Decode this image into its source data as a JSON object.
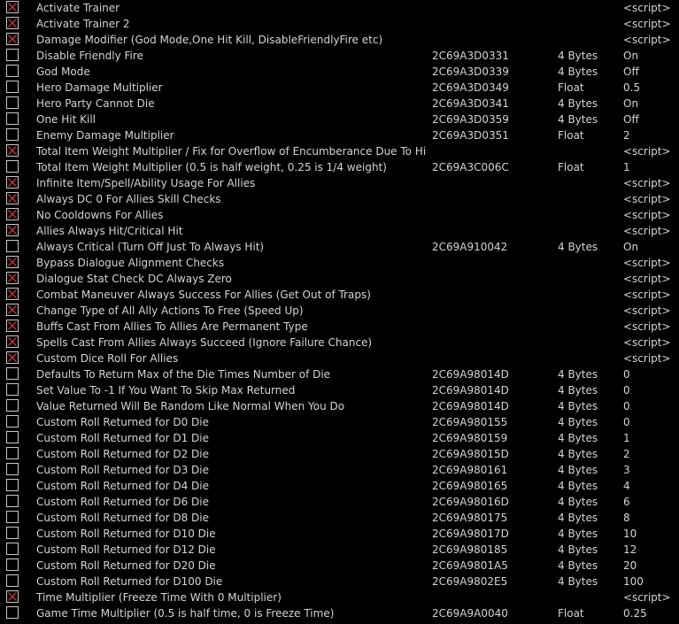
{
  "theme": {
    "background": "#000000",
    "text": "#d4d4d4",
    "check_mark": "#c0392b",
    "checkbox_border": "#c8c8c8"
  },
  "rows": [
    {
      "checked": true,
      "description": "Activate Trainer",
      "address": "",
      "type": "",
      "value": "<script>"
    },
    {
      "checked": true,
      "description": "Activate Trainer 2",
      "address": "",
      "type": "",
      "value": "<script>"
    },
    {
      "checked": true,
      "description": "Damage Modifier (God Mode,One Hit Kill, DisableFriendlyFire etc)",
      "address": "",
      "type": "",
      "value": "<script>"
    },
    {
      "checked": false,
      "description": "Disable Friendly Fire",
      "address": "2C69A3D0331",
      "type": "4 Bytes",
      "value": "On"
    },
    {
      "checked": false,
      "description": "God Mode",
      "address": "2C69A3D0339",
      "type": "4 Bytes",
      "value": "Off"
    },
    {
      "checked": false,
      "description": "Hero Damage Multiplier",
      "address": "2C69A3D0349",
      "type": "Float",
      "value": "0.5"
    },
    {
      "checked": false,
      "description": "Hero Party Cannot Die",
      "address": "2C69A3D0341",
      "type": "4 Bytes",
      "value": "On"
    },
    {
      "checked": false,
      "description": "One Hit Kill",
      "address": "2C69A3D0359",
      "type": "4 Bytes",
      "value": "Off"
    },
    {
      "checked": false,
      "description": "Enemy Damage Multiplier",
      "address": "2C69A3D0351",
      "type": "Float",
      "value": "2"
    },
    {
      "checked": true,
      "description": "Total Item Weight Multiplier / Fix for Overflow of Encumberance Due To High STR (Default Normal Weight)",
      "address": "",
      "type": "",
      "value": "<script>"
    },
    {
      "checked": false,
      "description": "Total Item Weight Multiplier (0.5 is half weight, 0.25 is 1/4 weight)",
      "address": "2C69A3C006C",
      "type": "Float",
      "value": "1"
    },
    {
      "checked": true,
      "description": "Infinite Item/Spell/Ability Usage For Allies",
      "address": "",
      "type": "",
      "value": "<script>"
    },
    {
      "checked": true,
      "description": "Always DC 0 For Allies Skill Checks",
      "address": "",
      "type": "",
      "value": "<script>"
    },
    {
      "checked": true,
      "description": "No Cooldowns For Allies",
      "address": "",
      "type": "",
      "value": "<script>"
    },
    {
      "checked": true,
      "description": "Allies Always Hit/Critical Hit",
      "address": "",
      "type": "",
      "value": "<script>"
    },
    {
      "checked": false,
      "description": "Always Critical (Turn Off Just To Always Hit)",
      "address": "2C69A910042",
      "type": "4 Bytes",
      "value": "On"
    },
    {
      "checked": true,
      "description": "Bypass Dialogue Alignment Checks",
      "address": "",
      "type": "",
      "value": "<script>"
    },
    {
      "checked": true,
      "description": "Dialogue Stat Check DC Always Zero",
      "address": "",
      "type": "",
      "value": "<script>"
    },
    {
      "checked": true,
      "description": "Combat Maneuver Always Success For Allies (Get Out of Traps)",
      "address": "",
      "type": "",
      "value": "<script>"
    },
    {
      "checked": true,
      "description": "Change Type of All Ally Actions To Free (Speed Up)",
      "address": "",
      "type": "",
      "value": "<script>"
    },
    {
      "checked": true,
      "description": "Buffs Cast From Allies To Allies Are Permanent Type",
      "address": "",
      "type": "",
      "value": "<script>"
    },
    {
      "checked": true,
      "description": "Spells Cast From Allies Always Succeed (Ignore Failure Chance)",
      "address": "",
      "type": "",
      "value": "<script>"
    },
    {
      "checked": true,
      "description": "Custom Dice Roll For Allies",
      "address": "",
      "type": "",
      "value": "<script>"
    },
    {
      "checked": false,
      "description": "Defaults To Return Max of the Die Times Number of Die",
      "address": "2C69A98014D",
      "type": "4 Bytes",
      "value": "0"
    },
    {
      "checked": false,
      "description": "Set Value To -1 If You Want To Skip Max Returned",
      "address": "2C69A98014D",
      "type": "4 Bytes",
      "value": "0"
    },
    {
      "checked": false,
      "description": "Value Returned Will Be Random Like Normal When You Do",
      "address": "2C69A98014D",
      "type": "4 Bytes",
      "value": "0"
    },
    {
      "checked": false,
      "description": "Custom Roll Returned for D0 Die",
      "address": "2C69A980155",
      "type": "4 Bytes",
      "value": "0"
    },
    {
      "checked": false,
      "description": "Custom Roll Returned for D1 Die",
      "address": "2C69A980159",
      "type": "4 Bytes",
      "value": "1"
    },
    {
      "checked": false,
      "description": "Custom Roll Returned for D2 Die",
      "address": "2C69A98015D",
      "type": "4 Bytes",
      "value": "2"
    },
    {
      "checked": false,
      "description": "Custom Roll Returned for D3 Die",
      "address": "2C69A980161",
      "type": "4 Bytes",
      "value": "3"
    },
    {
      "checked": false,
      "description": "Custom Roll Returned for D4 Die",
      "address": "2C69A980165",
      "type": "4 Bytes",
      "value": "4"
    },
    {
      "checked": false,
      "description": "Custom Roll Returned for D6 Die",
      "address": "2C69A98016D",
      "type": "4 Bytes",
      "value": "6"
    },
    {
      "checked": false,
      "description": "Custom Roll Returned for D8 Die",
      "address": "2C69A980175",
      "type": "4 Bytes",
      "value": "8"
    },
    {
      "checked": false,
      "description": "Custom Roll Returned for D10 Die",
      "address": "2C69A98017D",
      "type": "4 Bytes",
      "value": "10"
    },
    {
      "checked": false,
      "description": "Custom Roll Returned for D12 Die",
      "address": "2C69A980185",
      "type": "4 Bytes",
      "value": "12"
    },
    {
      "checked": false,
      "description": "Custom Roll Returned for D20 Die",
      "address": "2C69A9801A5",
      "type": "4 Bytes",
      "value": "20"
    },
    {
      "checked": false,
      "description": "Custom Roll Returned for D100 Die",
      "address": "2C69A9802E5",
      "type": "4 Bytes",
      "value": "100"
    },
    {
      "checked": true,
      "description": "Time Multiplier (Freeze Time With 0 Multiplier)",
      "address": "",
      "type": "",
      "value": "<script>"
    },
    {
      "checked": false,
      "description": "Game Time Multiplier (0.5 is half time, 0 is Freeze Time)",
      "address": "2C69A9A0040",
      "type": "Float",
      "value": "0.25"
    }
  ]
}
